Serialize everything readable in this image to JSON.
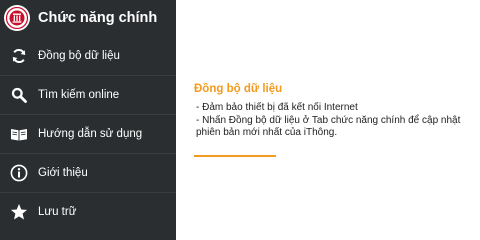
{
  "drawer": {
    "title": "Chức năng chính",
    "items": [
      {
        "label": "Đồng bộ dữ liệu",
        "icon": "sync-icon"
      },
      {
        "label": "Tìm kiếm online",
        "icon": "search-icon"
      },
      {
        "label": "Hướng dẫn sử dụng",
        "icon": "book-icon"
      },
      {
        "label": "Giới thiệu",
        "icon": "info-icon"
      },
      {
        "label": "Lưu trữ",
        "icon": "star-icon"
      }
    ]
  },
  "content": {
    "title": "Đồng bộ dữ liệu",
    "lines": [
      "- Đảm bảo thiết bị đã kết nối Internet",
      "- Nhấn Đồng bộ dữ liệu ở Tab chức năng chính để cập nhật phiên bản mới nhất của iThông."
    ]
  },
  "colors": {
    "drawer_bg": "#2b2e31",
    "accent": "#f39a1f",
    "logo_red": "#c8102e"
  }
}
